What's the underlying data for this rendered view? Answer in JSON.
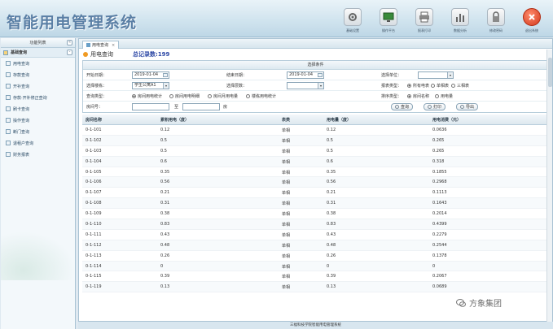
{
  "app": {
    "title": "智能用电管理系统"
  },
  "toolbar": [
    {
      "label": "基础设置",
      "icon": "gear-icon"
    },
    {
      "label": "操作平台",
      "icon": "monitor-icon"
    },
    {
      "label": "报表打印",
      "icon": "printer-icon"
    },
    {
      "label": "数据分析",
      "icon": "bar-chart-icon"
    },
    {
      "label": "修改密码",
      "icon": "lock-icon"
    },
    {
      "label": "退出系统",
      "icon": "close-icon"
    }
  ],
  "sidebar": {
    "title": "功能列表",
    "group": "基础查询",
    "items": [
      "用电查询",
      "存款查询",
      "开补查询",
      "存款·开补修正查询",
      "刷卡查询",
      "操作查询",
      "断门查询",
      "退租户查询",
      "财务报表"
    ]
  },
  "tab": {
    "label": "用电查询"
  },
  "info": {
    "title": "用电查询",
    "total_label": "总记录数:",
    "total_count": "199"
  },
  "filter": {
    "title": "选择条件",
    "start_date_label": "开始日期：",
    "start_date": "2019-01-04",
    "end_date_label": "结束日期：",
    "end_date": "2019-01-04",
    "select_unit_label": "选择单位：",
    "building_label": "选择楼栋：",
    "building_value": "学生公寓A1",
    "floor_label": "选择层数：",
    "report_type_label": "报表类型：",
    "report_types": [
      "所有电表",
      "单相表",
      "三相表"
    ],
    "query_type_label": "查询类型：",
    "query_types": [
      "房间用电统计",
      "房间用电明细",
      "房间月用电量",
      "楼栋用电统计"
    ],
    "sort_type_label": "排序类型：",
    "sort_types": [
      "房间名称",
      "用电量"
    ],
    "room_no_label": "房间号：",
    "room_to": "至",
    "room_unit": "房",
    "query_button": "查询",
    "print_button": "打印",
    "export_button": "导出"
  },
  "grid": {
    "headers": [
      "房间名称",
      "累积用电（度）",
      "表类",
      "用电量（度）",
      "用电消费（元）"
    ],
    "rows": [
      [
        "0-1-101",
        "0.12",
        "单相",
        "0.12",
        "0.0636"
      ],
      [
        "0-1-102",
        "0.5",
        "单相",
        "0.5",
        "0.265"
      ],
      [
        "0-1-103",
        "0.5",
        "单相",
        "0.5",
        "0.265"
      ],
      [
        "0-1-104",
        "0.6",
        "单相",
        "0.6",
        "0.318"
      ],
      [
        "0-1-105",
        "0.35",
        "单相",
        "0.35",
        "0.1855"
      ],
      [
        "0-1-106",
        "0.56",
        "单相",
        "0.56",
        "0.2968"
      ],
      [
        "0-1-107",
        "0.21",
        "单相",
        "0.21",
        "0.1113"
      ],
      [
        "0-1-108",
        "0.31",
        "单相",
        "0.31",
        "0.1643"
      ],
      [
        "0-1-109",
        "0.38",
        "单相",
        "0.38",
        "0.2014"
      ],
      [
        "0-1-110",
        "0.83",
        "单相",
        "0.83",
        "0.4399"
      ],
      [
        "0-1-111",
        "0.43",
        "单相",
        "0.43",
        "0.2279"
      ],
      [
        "0-1-112",
        "0.48",
        "单相",
        "0.48",
        "0.2544"
      ],
      [
        "0-1-113",
        "0.26",
        "单相",
        "0.26",
        "0.1378"
      ],
      [
        "0-1-114",
        "0",
        "单相",
        "0",
        "0"
      ],
      [
        "0-1-115",
        "0.39",
        "单相",
        "0.39",
        "0.2067"
      ],
      [
        "0-1-119",
        "0.13",
        "单相",
        "0.13",
        "0.0689"
      ]
    ]
  },
  "footer": {
    "text": "三福科技学院智能用电管理系统"
  },
  "watermark": {
    "text": "方象集团"
  }
}
